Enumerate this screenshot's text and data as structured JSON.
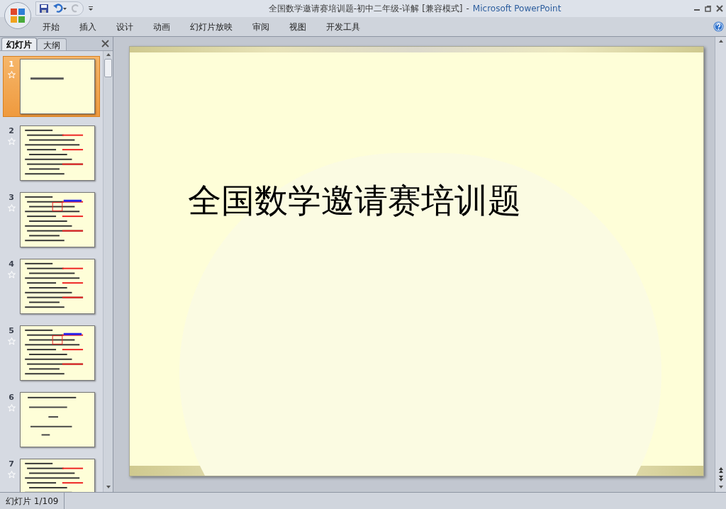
{
  "window": {
    "document": "全国数学邀请赛培训题-初中二年级-详解 [兼容模式]",
    "separator": "-",
    "app": "Microsoft PowerPoint"
  },
  "ribbon_tabs": [
    {
      "label": "开始",
      "selected": false
    },
    {
      "label": "插入",
      "selected": false
    },
    {
      "label": "设计",
      "selected": false
    },
    {
      "label": "动画",
      "selected": false
    },
    {
      "label": "幻灯片放映",
      "selected": false
    },
    {
      "label": "审阅",
      "selected": false
    },
    {
      "label": "视图",
      "selected": false
    },
    {
      "label": "开发工具",
      "selected": false
    }
  ],
  "pane_tabs": [
    {
      "label": "幻灯片",
      "selected": true
    },
    {
      "label": "大纲",
      "selected": false
    }
  ],
  "slides": [
    {
      "number": "1",
      "kind": "title",
      "selected": true
    },
    {
      "number": "2",
      "kind": "content",
      "selected": false
    },
    {
      "number": "3",
      "kind": "diagram",
      "selected": false
    },
    {
      "number": "4",
      "kind": "content",
      "selected": false
    },
    {
      "number": "5",
      "kind": "diagram",
      "selected": false
    },
    {
      "number": "6",
      "kind": "sparse",
      "selected": false
    },
    {
      "number": "7",
      "kind": "content",
      "selected": false
    }
  ],
  "slide": {
    "title": "全国数学邀请赛培训题"
  },
  "status_bar": {
    "slide_counter": "幻灯片 1/109"
  }
}
